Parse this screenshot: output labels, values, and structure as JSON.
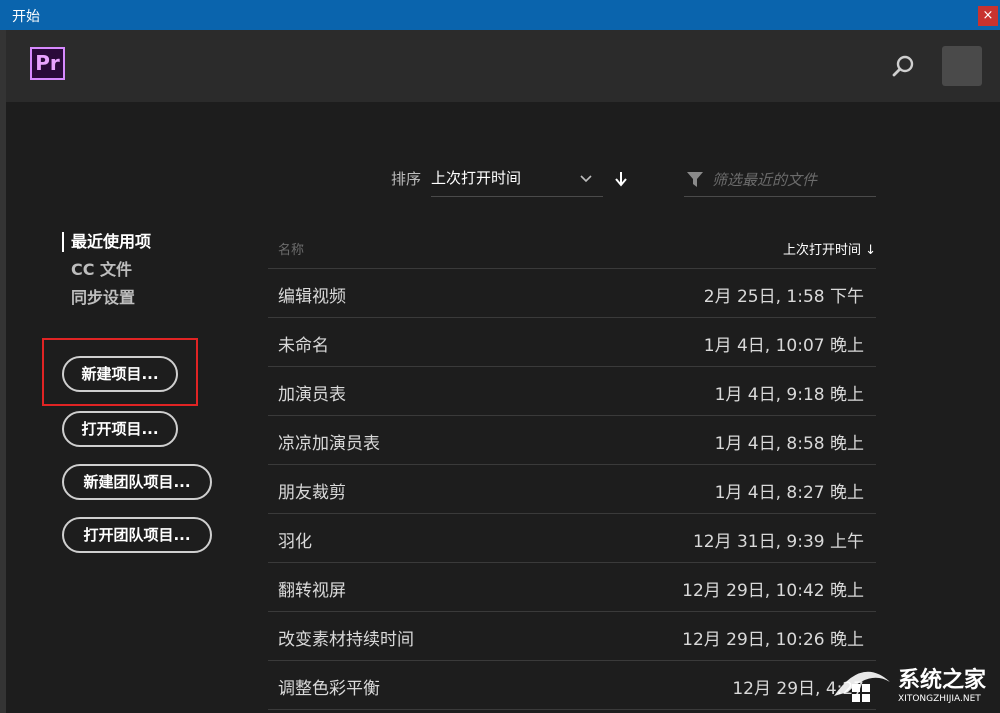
{
  "window": {
    "title": "开始",
    "close_label": "×"
  },
  "header": {
    "logo_text": "Pr",
    "search_icon": "search-icon"
  },
  "nav": {
    "items": [
      {
        "label": "最近使用项",
        "active": true
      },
      {
        "label": "CC 文件",
        "active": false
      },
      {
        "label": "同步设置",
        "active": false
      }
    ]
  },
  "actions": {
    "new_project": "新建项目...",
    "open_project": "打开项目...",
    "new_team_project": "新建团队项目...",
    "open_team_project": "打开团队项目..."
  },
  "sort": {
    "label": "排序",
    "selected": "上次打开时间"
  },
  "filter": {
    "placeholder": "筛选最近的文件"
  },
  "table": {
    "headers": {
      "name": "名称",
      "date": "上次打开时间 ↓"
    },
    "rows": [
      {
        "name": "编辑视频",
        "date": "2月 25日, 1:58 下午"
      },
      {
        "name": "未命名",
        "date": "1月 4日, 10:07 晚上"
      },
      {
        "name": "加演员表",
        "date": "1月 4日, 9:18 晚上"
      },
      {
        "name": "凉凉加演员表",
        "date": "1月 4日, 8:58 晚上"
      },
      {
        "name": "朋友裁剪",
        "date": "1月 4日, 8:27 晚上"
      },
      {
        "name": "羽化",
        "date": "12月 31日, 9:39 上午"
      },
      {
        "name": "翻转视屏",
        "date": "12月 29日, 10:42 晚上"
      },
      {
        "name": "改变素材持续时间",
        "date": "12月 29日, 10:26 晚上"
      },
      {
        "name": "调整色彩平衡",
        "date": "12月 29日, 4:27"
      }
    ]
  },
  "watermark": {
    "text": "系统之家",
    "sub": "XITONGZHIJIA.NET"
  },
  "colors": {
    "titlebar": "#0a64ad",
    "accent": "#d78aff",
    "highlight": "#e02424"
  }
}
